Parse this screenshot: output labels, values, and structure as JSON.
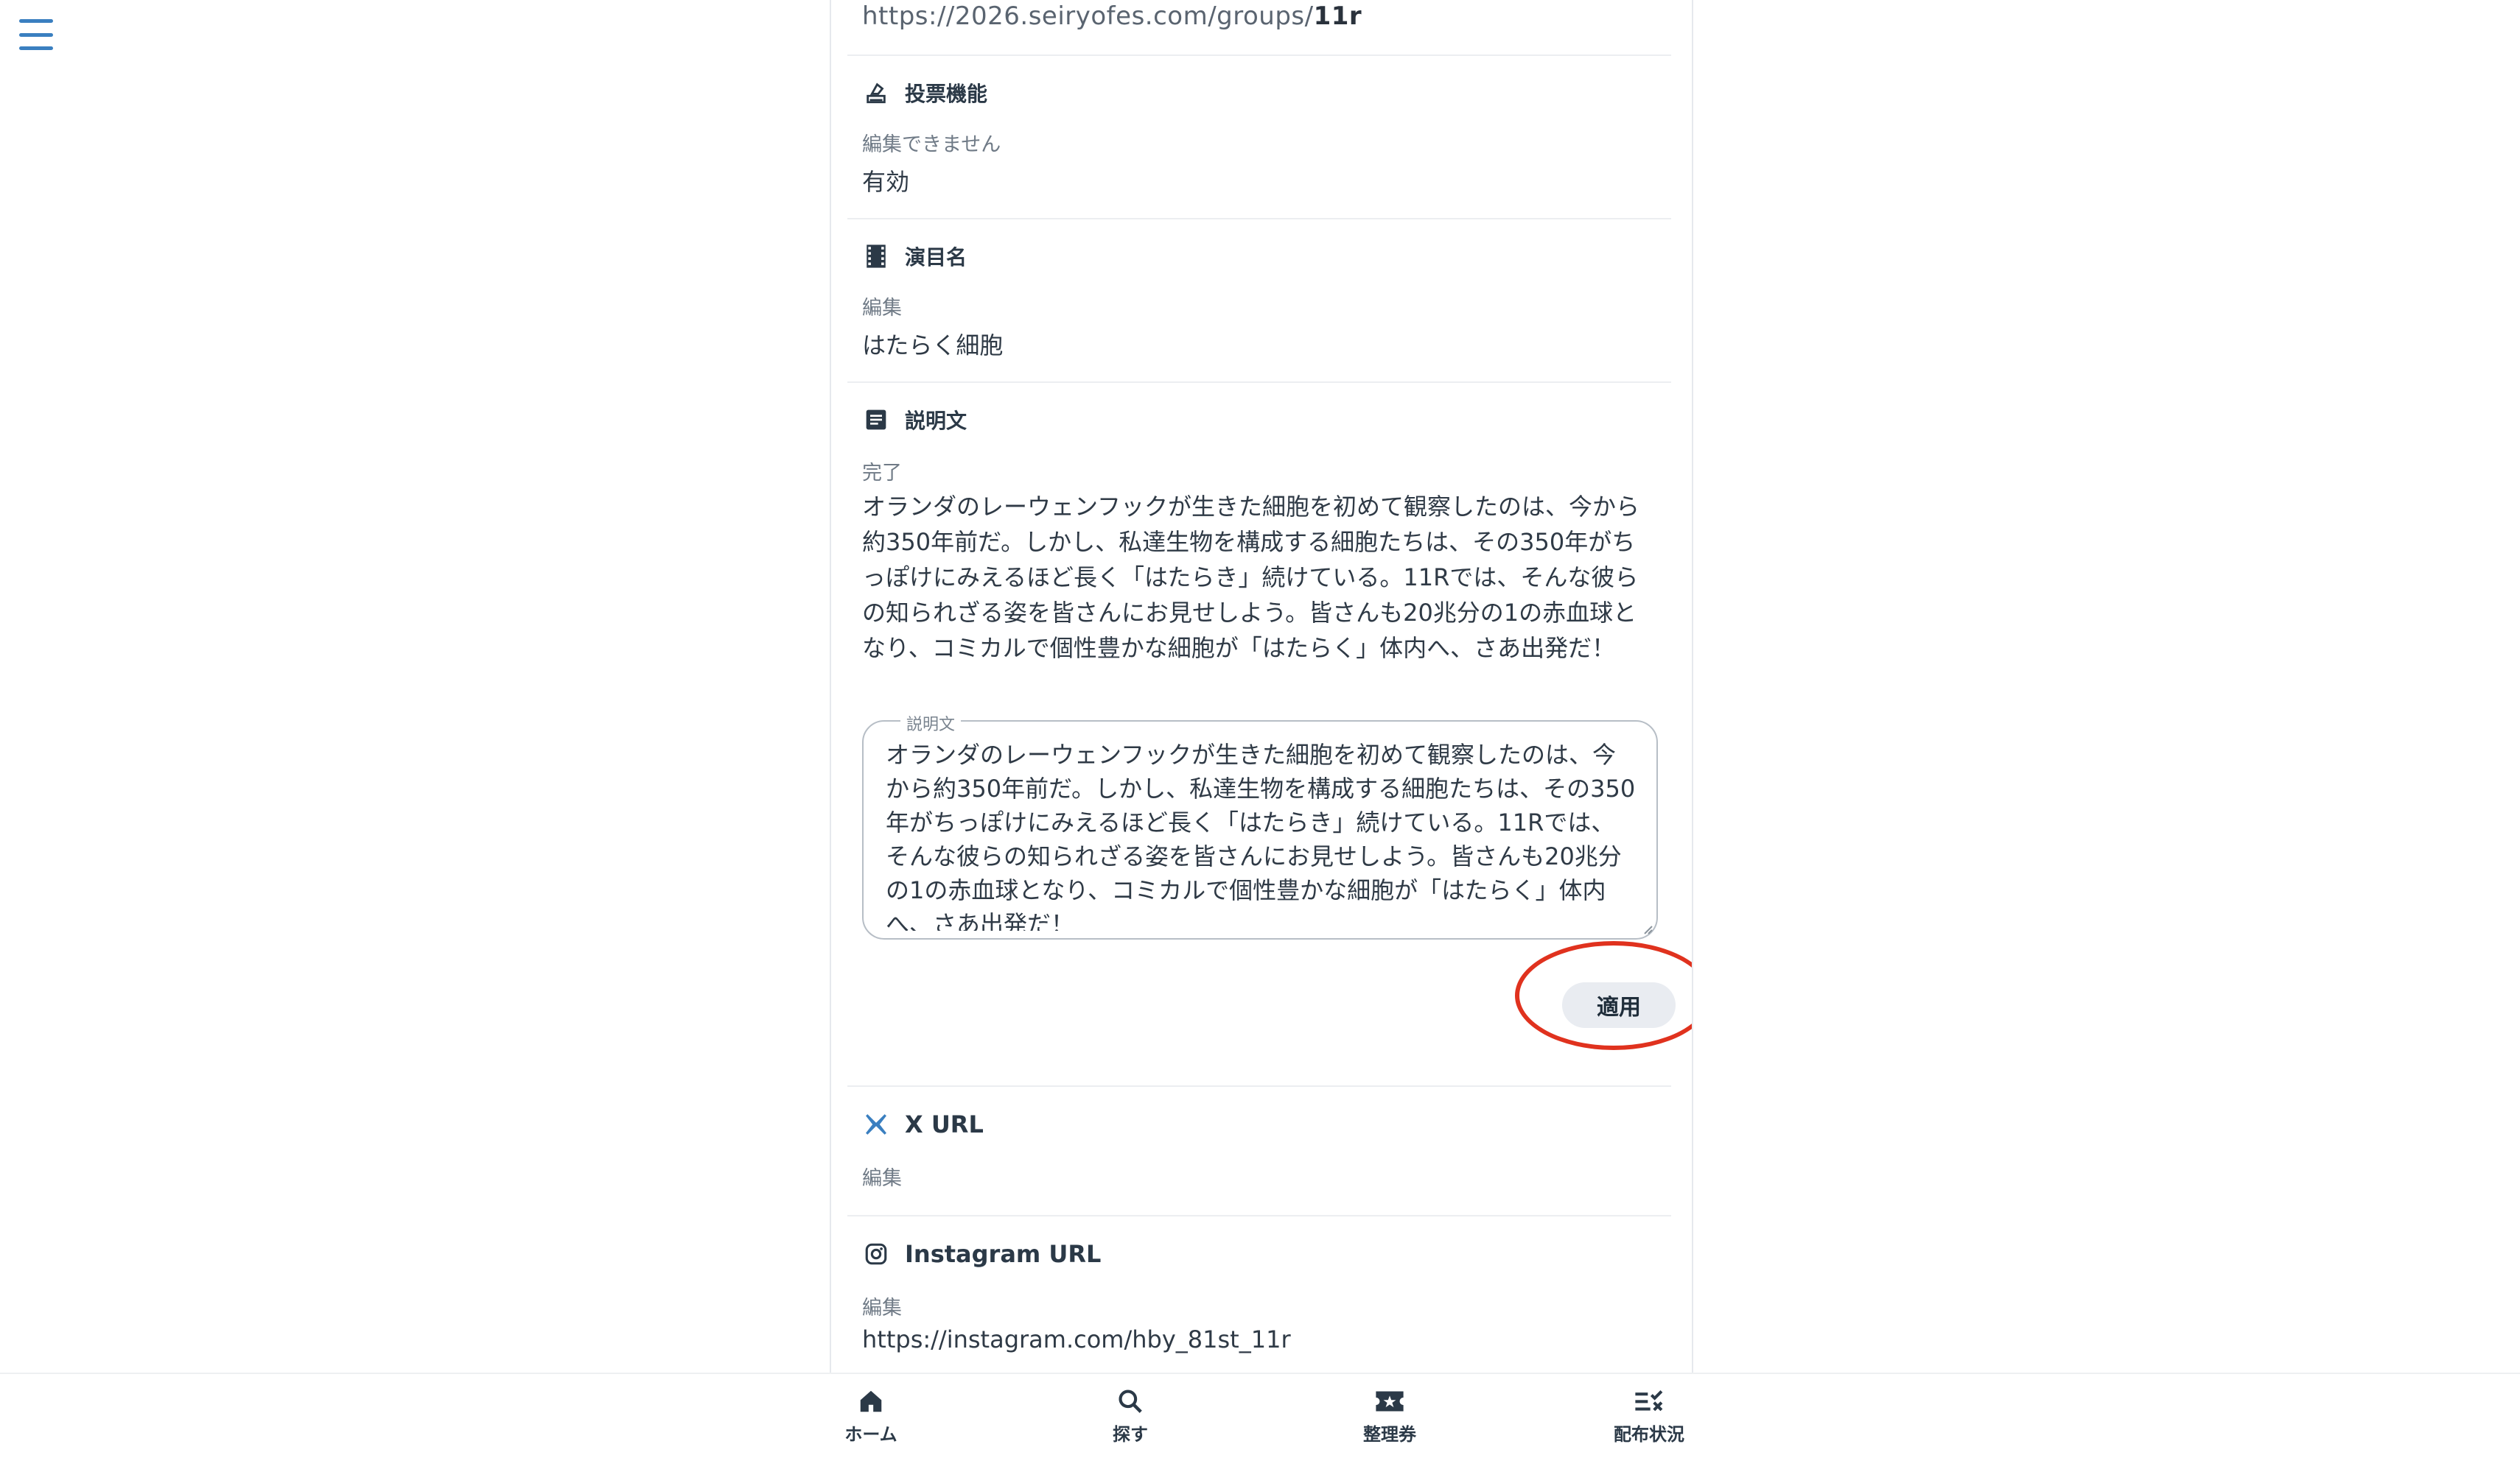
{
  "top_url": {
    "prefix": "https://2026.seiryofes.com/groups/",
    "slug": "11r"
  },
  "sections": {
    "vote": {
      "title": "投票機能",
      "status": "編集できません",
      "value": "有効",
      "icon": "vote-box-icon"
    },
    "program": {
      "title": "演目名",
      "status": "編集",
      "value": "はたらく細胞",
      "icon": "film-icon"
    },
    "description": {
      "title": "説明文",
      "status": "完了",
      "text": "オランダのレーウェンフックが生きた細胞を初めて観察したのは、今から約350年前だ。しかし、私達生物を構成する細胞たちは、その350年がちっぽけにみえるほど長く「はたらき」続けている。11Rでは、そんな彼らの知られざる姿を皆さんにお見せしよう。皆さんも20兆分の1の赤血球となり、コミカルで個性豊かな細胞が「はたらく」体内へ、さあ出発だ！",
      "field_label": "説明文",
      "field_value": "オランダのレーウェンフックが生きた細胞を初めて観察したのは、今から約350年前だ。しかし、私達生物を構成する細胞たちは、その350年がちっぽけにみえるほど長く「はたらき」続けている。11Rでは、そんな彼らの知られざる姿を皆さんにお見せしよう。皆さんも20兆分の1の赤血球となり、コミカルで個性豊かな細胞が「はたらく」体内へ、さあ出発だ！",
      "apply_label": "適用",
      "icon": "document-icon"
    },
    "x_url": {
      "title": "X URL",
      "status": "編集",
      "icon": "x-logo-icon"
    },
    "instagram_url": {
      "title": "Instagram URL",
      "status": "編集",
      "value": "https://instagram.com/hby_81st_11r",
      "icon": "instagram-icon"
    }
  },
  "bottom_nav": [
    {
      "label": "ホーム",
      "icon": "home-icon"
    },
    {
      "label": "探す",
      "icon": "search-icon"
    },
    {
      "label": "整理券",
      "icon": "ticket-icon"
    },
    {
      "label": "配布状況",
      "icon": "checklist-icon"
    }
  ],
  "colors": {
    "accent": "#3a7fc0",
    "highlight": "#e0321e",
    "button_bg": "#e9ecf1"
  }
}
